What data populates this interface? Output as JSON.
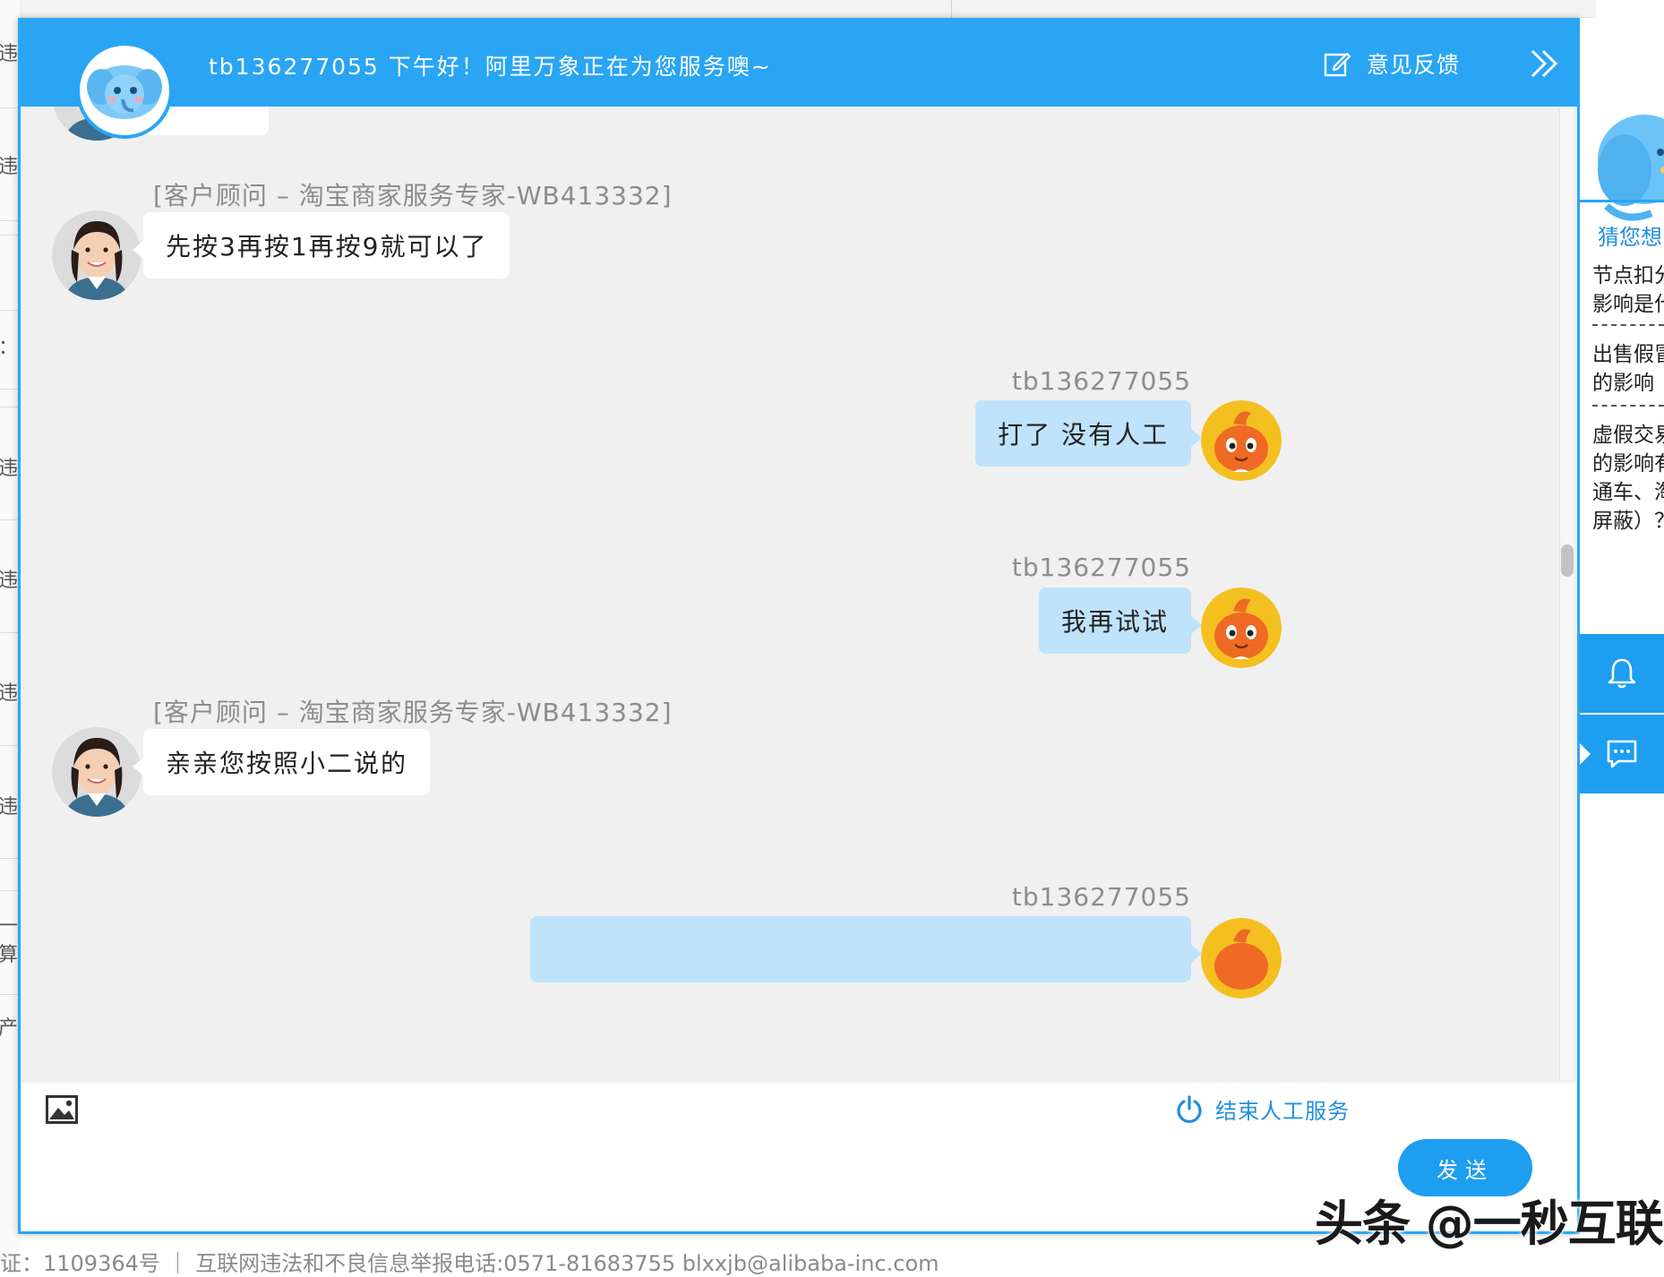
{
  "header": {
    "greeting": "tb136277055 下午好！阿里万象正在为您服务噢~",
    "feedback_label": "意见反馈"
  },
  "chat": {
    "agent_name": "[客户顾问 – 淘宝商家服务专家-WB413332]",
    "user_name": "tb136277055",
    "messages": [
      {
        "from": "agent",
        "text": "先按3再按1再按9就可以了"
      },
      {
        "from": "user",
        "text": "打了 没有人工"
      },
      {
        "from": "user",
        "text": "我再试试"
      },
      {
        "from": "agent",
        "text": "亲亲您按照小二说的"
      }
    ]
  },
  "input": {
    "end_service_label": "结束人工服务",
    "send_label": "发送"
  },
  "side_panel": {
    "guess_title": "猜您想",
    "entries": [
      [
        "节点扣分",
        "影响是什"
      ],
      [
        "出售假冒",
        "的影响"
      ],
      [
        "虚假交易",
        "的影响有",
        "通车、淘",
        "屏蔽）？"
      ]
    ]
  },
  "footer_text": "证：1109364号 ｜ 互联网违法和不良信息举报电话:0571-81683755 blxxjb@alibaba-inc.com",
  "watermark": "头条 @一秒互联",
  "background_fragments": [
    "违",
    "违",
    "：",
    "违",
    "违",
    "违",
    "违",
    "一算",
    "产"
  ],
  "colors": {
    "header_blue": "#29a5f4",
    "user_bubble": "#bfe3fa",
    "agent_bubble": "#ffffff",
    "send_button": "#1e9ef0",
    "link_blue": "#1f8fe0"
  }
}
